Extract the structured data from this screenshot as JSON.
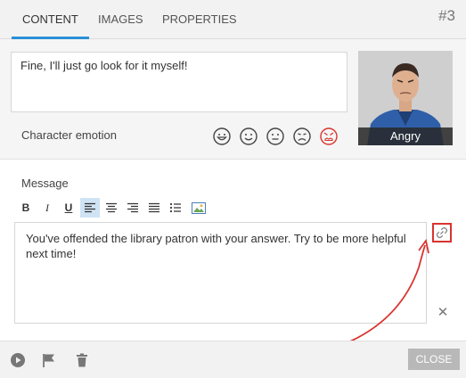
{
  "tabs": [
    {
      "label": "CONTENT",
      "active": true
    },
    {
      "label": "IMAGES",
      "active": false
    },
    {
      "label": "PROPERTIES",
      "active": false
    }
  ],
  "scene_number": "#3",
  "content_text": "Fine, I'll just go look for it myself!",
  "emotion": {
    "label": "Character emotion",
    "options": [
      "happy-icon",
      "smile-icon",
      "neutral-icon",
      "sad-icon",
      "angry-icon"
    ],
    "selected": "angry-icon",
    "selected_color": "#d9332f"
  },
  "portrait": {
    "caption": "Angry"
  },
  "message": {
    "label": "Message",
    "text": "You've offended the library patron with your answer. Try to be more helpful next time!",
    "toolbar": [
      {
        "name": "bold-button",
        "glyph": "B"
      },
      {
        "name": "italic-button",
        "glyph": "I"
      },
      {
        "name": "underline-button",
        "glyph": "U"
      },
      {
        "name": "align-left-button",
        "glyph": "align-left",
        "active": true
      },
      {
        "name": "align-center-button",
        "glyph": "align-center"
      },
      {
        "name": "align-right-button",
        "glyph": "align-right"
      },
      {
        "name": "align-justify-button",
        "glyph": "align-justify"
      },
      {
        "name": "bullet-list-button",
        "glyph": "list"
      },
      {
        "name": "insert-image-button",
        "glyph": "image"
      }
    ]
  },
  "footer": {
    "close_label": "CLOSE"
  },
  "colors": {
    "accent": "#2a8fd6",
    "highlight_red": "#d9332f"
  }
}
